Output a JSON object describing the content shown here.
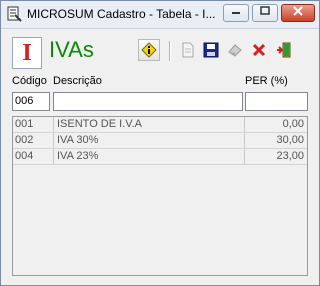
{
  "window": {
    "title": "MICROSUM Cadastro - Tabela - I..."
  },
  "header": {
    "heading": "IVAs",
    "doc_letter": "I"
  },
  "labels": {
    "code": "Código",
    "description": "Descrição",
    "per": "PER (%)"
  },
  "form": {
    "code_value": "006",
    "description_value": "",
    "per_value": ""
  },
  "rows": [
    {
      "code": "001",
      "description": "ISENTO DE I.V.A",
      "per": "0,00"
    },
    {
      "code": "002",
      "description": "IVA 30%",
      "per": "30,00"
    },
    {
      "code": "004",
      "description": "IVA 23%",
      "per": "23,00"
    }
  ],
  "icons": {
    "app": "app-icon",
    "info": "info-icon",
    "new": "new-document-icon",
    "save": "save-icon",
    "erase": "eraser-icon",
    "delete": "delete-icon",
    "exit": "exit-door-icon"
  },
  "colors": {
    "heading": "#0a8a0a",
    "doc_letter": "#d42020",
    "delete": "#d42020"
  }
}
